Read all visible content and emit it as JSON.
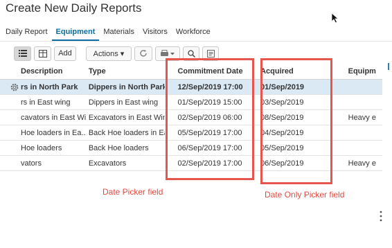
{
  "page": {
    "title": "Create New Daily Reports"
  },
  "tabs": [
    {
      "label": "Daily Report",
      "active": false
    },
    {
      "label": "Equipment",
      "active": true
    },
    {
      "label": "Materials",
      "active": false
    },
    {
      "label": "Visitors",
      "active": false
    },
    {
      "label": "Workforce",
      "active": false
    }
  ],
  "toolbar": {
    "list_view_icon": "list-icon",
    "grid_view_icon": "grid-icon",
    "add_label": "Add",
    "actions_label": "Actions ▾",
    "refresh_icon": "refresh-icon",
    "print_icon": "print-icon",
    "search_icon": "search-icon",
    "export_icon": "export-icon"
  },
  "table": {
    "columns": [
      "Description",
      "Type",
      "Commitment Date",
      "Acquired",
      "Equipm"
    ],
    "rows": [
      {
        "description": "rs in North Park",
        "type": "Dippers in North Park",
        "commitment_date": "12/Sep/2019 17:00",
        "acquired": "01/Sep/2019",
        "equipment": "",
        "selected": true
      },
      {
        "description": "rs in East wing",
        "type": "Dippers in East wing",
        "commitment_date": "01/Sep/2019 15:00",
        "acquired": "03/Sep/2019",
        "equipment": "",
        "selected": false
      },
      {
        "description": "cavators in East Wing",
        "type": "Excavators in East Wing",
        "commitment_date": "02/Sep/2019 06:00",
        "acquired": "08/Sep/2019",
        "equipment": "Heavy e",
        "selected": false
      },
      {
        "description": "Hoe loaders in Ea...",
        "type": "Back Hoe loaders in Ea...",
        "commitment_date": "05/Sep/2019 17:00",
        "acquired": "04/Sep/2019",
        "equipment": "",
        "selected": false
      },
      {
        "description": "Hoe loaders",
        "type": "Back Hoe loaders",
        "commitment_date": "06/Sep/2019 17:00",
        "acquired": "05/Sep/2019",
        "equipment": "",
        "selected": false
      },
      {
        "description": "vators",
        "type": "Excavators",
        "commitment_date": "02/Sep/2019 17:00",
        "acquired": "06/Sep/2019",
        "equipment": "Heavy e",
        "selected": false
      }
    ]
  },
  "annotations": {
    "commit_label": "Date Picker field",
    "acquired_label": "Date Only Picker field",
    "highlight_color": "#e8554e"
  },
  "colors": {
    "accent": "#0a6ca3",
    "selected_row": "#dbe9f5"
  }
}
